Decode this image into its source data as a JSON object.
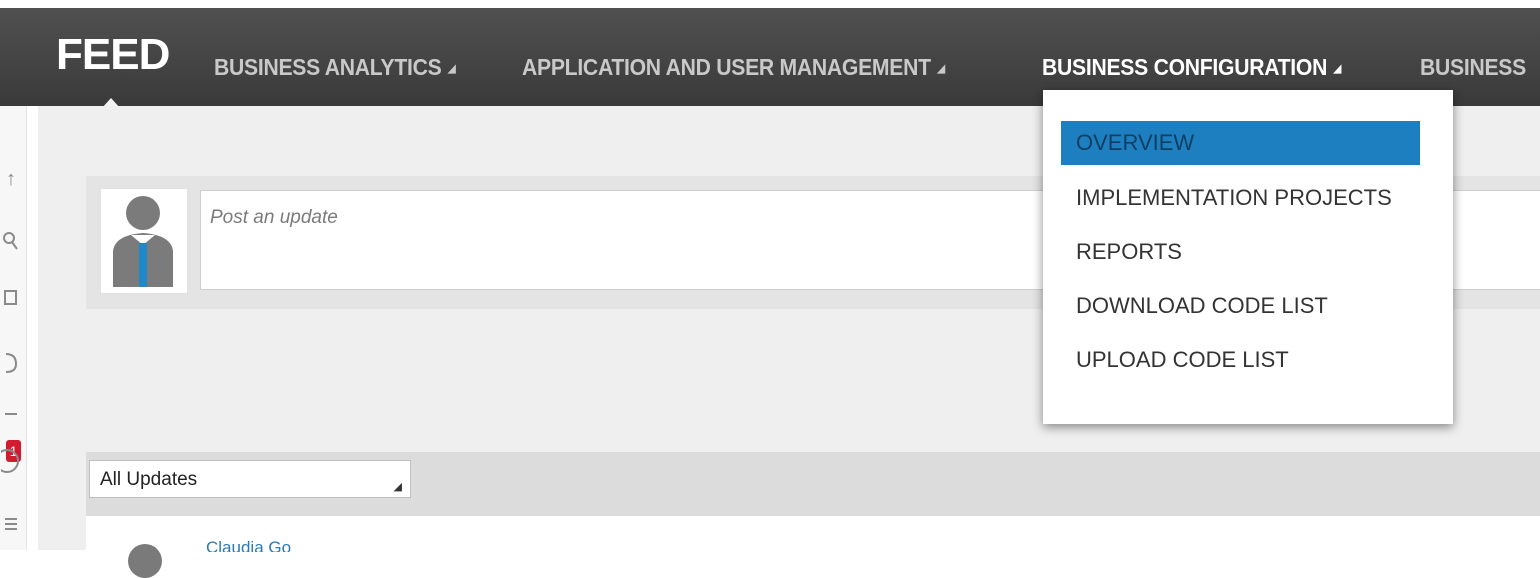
{
  "nav": {
    "feed_label": "FEED",
    "items": [
      {
        "label": "BUSINESS ANALYTICS"
      },
      {
        "label": "APPLICATION AND USER MANAGEMENT"
      },
      {
        "label": "BUSINESS CONFIGURATION"
      },
      {
        "label": "BUSINESS"
      }
    ],
    "arrow_glyph": "◢"
  },
  "sidebar": {
    "notification_count": "1",
    "icons": [
      "arrow-icon",
      "search-icon",
      "square-icon",
      "bell-icon",
      "dash-icon",
      "dollar-icon",
      "list-icon"
    ]
  },
  "post": {
    "placeholder": "Post an update"
  },
  "filter": {
    "selected": "All Updates"
  },
  "feed_item": {
    "author": "Claudia Go"
  },
  "dropdown": {
    "items": [
      {
        "label": "OVERVIEW"
      },
      {
        "label": "IMPLEMENTATION PROJECTS"
      },
      {
        "label": "REPORTS"
      },
      {
        "label": "DOWNLOAD CODE LIST"
      },
      {
        "label": "UPLOAD CODE LIST"
      }
    ]
  },
  "colors": {
    "nav_bg": "#444444",
    "accent": "#1e7fc0",
    "badge": "#d21b2f"
  }
}
